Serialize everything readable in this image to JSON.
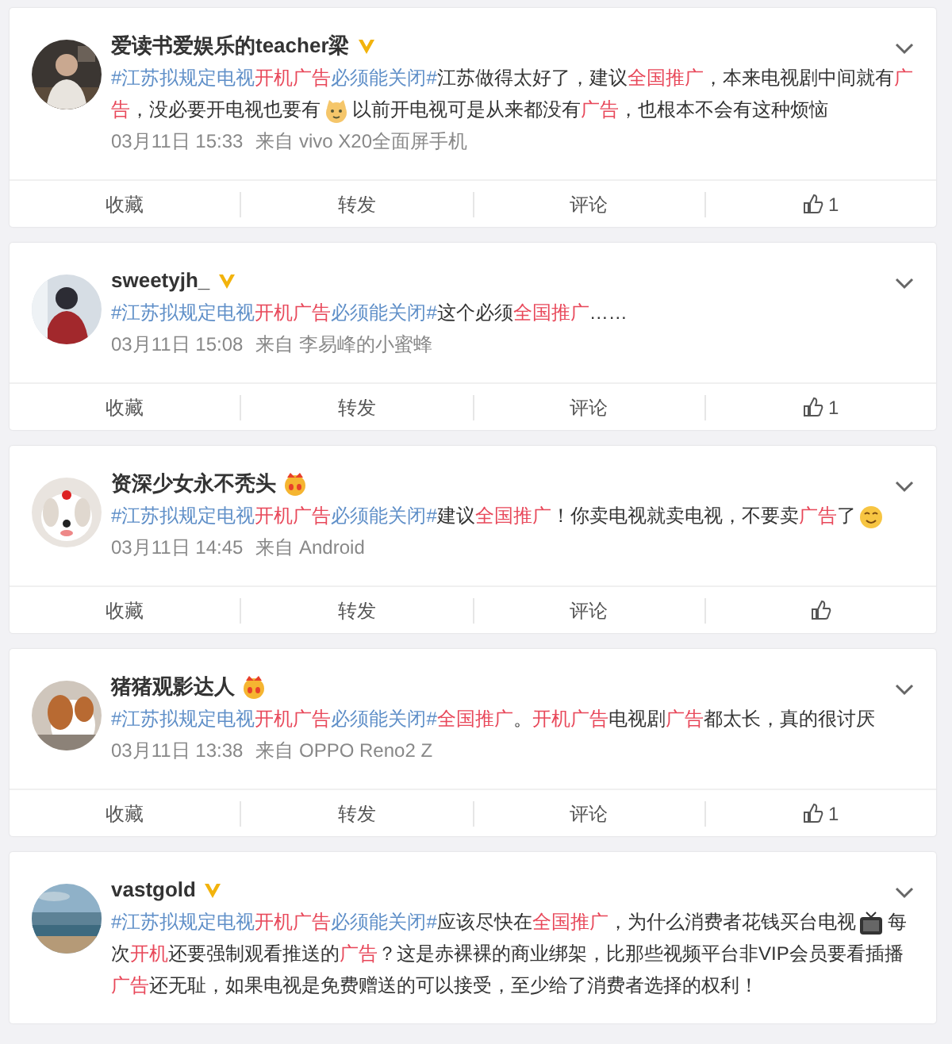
{
  "posts": [
    {
      "user": "爱读书爱娱乐的teacher梁",
      "verified": true,
      "topic": [
        {
          "text": "#江苏拟规定电视",
          "kind": "plain"
        },
        {
          "text": "开机广告",
          "kind": "keyword"
        },
        {
          "text": "必须能关闭#",
          "kind": "plain"
        }
      ],
      "body": [
        {
          "kind": "text",
          "text": "江苏做得太好了，建议"
        },
        {
          "kind": "keyword",
          "text": "全国推广"
        },
        {
          "kind": "text",
          "text": "，本来电视剧中间就有"
        },
        {
          "kind": "keyword",
          "text": "广告"
        },
        {
          "kind": "text",
          "text": "，没必要开电视也要有"
        },
        {
          "kind": "cat_emoji"
        },
        {
          "kind": "text",
          "text": "以前开电视可是从来都没有"
        },
        {
          "kind": "keyword",
          "text": "广告"
        },
        {
          "kind": "text",
          "text": "，也根本不会有这种烦恼"
        }
      ],
      "time": "03月11日 15:33",
      "source": "来自 vivo X20全面屏手机",
      "actions": [
        "收藏",
        "转发",
        "评论"
      ],
      "likes": "1"
    },
    {
      "user": "sweetyjh_",
      "verified": true,
      "topic": [
        {
          "text": "#江苏拟规定电视",
          "kind": "plain"
        },
        {
          "text": "开机广告",
          "kind": "keyword"
        },
        {
          "text": "必须能关闭#",
          "kind": "plain"
        }
      ],
      "body": [
        {
          "kind": "text",
          "text": "这个必须"
        },
        {
          "kind": "keyword",
          "text": "全国推广"
        },
        {
          "kind": "text",
          "text": "……"
        }
      ],
      "time": "03月11日 15:08",
      "source": "来自 李易峰的小蜜蜂",
      "actions": [
        "收藏",
        "转发",
        "评论"
      ],
      "likes": "1"
    },
    {
      "user": "资深少女永不秃头",
      "member": true,
      "topic": [
        {
          "text": "#江苏拟规定电视",
          "kind": "plain"
        },
        {
          "text": "开机广告",
          "kind": "keyword"
        },
        {
          "text": "必须能关闭#",
          "kind": "plain"
        }
      ],
      "body": [
        {
          "kind": "text",
          "text": "建议"
        },
        {
          "kind": "keyword",
          "text": "全国推广"
        },
        {
          "kind": "text",
          "text": "！你卖电视就卖电视，不要卖"
        },
        {
          "kind": "keyword",
          "text": "广告"
        },
        {
          "kind": "text",
          "text": "了"
        },
        {
          "kind": "smile_emoji"
        }
      ],
      "time": "03月11日 14:45",
      "source": "来自 Android",
      "actions": [
        "收藏",
        "转发",
        "评论"
      ]
    },
    {
      "user": "猪猪观影达人",
      "member": true,
      "topic": [
        {
          "text": "#江苏拟规定电视",
          "kind": "plain"
        },
        {
          "text": "开机广告",
          "kind": "keyword"
        },
        {
          "text": "必须能关闭#",
          "kind": "plain"
        }
      ],
      "body": [
        {
          "kind": "keyword",
          "text": "全国推广"
        },
        {
          "kind": "text",
          "text": "。"
        },
        {
          "kind": "keyword",
          "text": "开机广告"
        },
        {
          "kind": "text",
          "text": "电视剧"
        },
        {
          "kind": "keyword",
          "text": "广告"
        },
        {
          "kind": "text",
          "text": "都太长，真的很讨厌"
        }
      ],
      "time": "03月11日 13:38",
      "source": "来自 OPPO Reno2 Z",
      "actions": [
        "收藏",
        "转发",
        "评论"
      ],
      "likes": "1"
    },
    {
      "user": "vastgold",
      "verified": true,
      "topic": [
        {
          "text": "#江苏拟规定电视",
          "kind": "plain"
        },
        {
          "text": "开机广告",
          "kind": "keyword"
        },
        {
          "text": "必须能关闭#",
          "kind": "plain"
        }
      ],
      "body": [
        {
          "kind": "text",
          "text": "应该尽快在"
        },
        {
          "kind": "keyword",
          "text": "全国推广"
        },
        {
          "kind": "text",
          "text": "，为什么消费者花钱买台电视"
        },
        {
          "kind": "tv_emoji"
        },
        {
          "kind": "text",
          "text": "每次"
        },
        {
          "kind": "keyword",
          "text": "开机"
        },
        {
          "kind": "text",
          "text": "还要强制观看推送的"
        },
        {
          "kind": "keyword",
          "text": "广告"
        },
        {
          "kind": "text",
          "text": "？这是赤裸裸的商业绑架，比那些视频平台非VIP会员要看插播"
        },
        {
          "kind": "keyword",
          "text": "广告"
        },
        {
          "kind": "text",
          "text": "还无耻，如果电视是免费赠送的可以接受，至少给了消费者选择的权利！"
        }
      ]
    }
  ]
}
